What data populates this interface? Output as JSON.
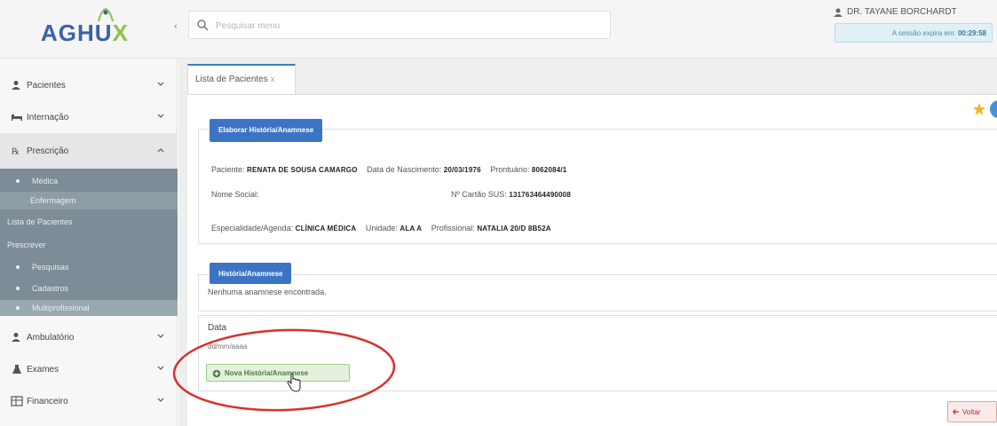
{
  "header": {
    "logo_text_main": "AGHU",
    "logo_text_accent": "X",
    "search_placeholder": "Pesquisar menu",
    "user_name": "DR. TAYANE BORCHARDT",
    "session_label": "A sessão expira em:",
    "session_time": "00:29:58"
  },
  "sidebar": {
    "items": [
      {
        "label": "Pacientes"
      },
      {
        "label": "Internação"
      },
      {
        "label": "Prescrição"
      },
      {
        "label": "Ambulatório"
      },
      {
        "label": "Exames"
      },
      {
        "label": "Financeiro"
      }
    ],
    "submenu": [
      {
        "label": "Médica"
      },
      {
        "label": "Enfermagem"
      },
      {
        "label": "Lista de Pacientes"
      },
      {
        "label": "Prescrever"
      },
      {
        "label": "Pesquisas"
      },
      {
        "label": "Cadastros"
      },
      {
        "label": "Multiprofissional"
      }
    ]
  },
  "tab": {
    "label": "Lista de Pacientes",
    "close": "x"
  },
  "panel1": {
    "button": "Elaborar História/Anamnese",
    "paciente_label": "Paciente:",
    "paciente_value": "RENATA DE SOUSA CAMARGO",
    "nascimento_label": "Data de Nascimento:",
    "nascimento_value": "20/03/1976",
    "prontuario_label": "Prontuário:",
    "prontuario_value": "8062084/1",
    "nome_social_label": "Nome Social:",
    "cartao_label": "Nº Cartão SUS:",
    "cartao_value": "131763464490008",
    "especialidade_label": "Especialidade/Agenda:",
    "especialidade_value": "CLÍNICA MÉDICA",
    "unidade_label": "Unidade:",
    "unidade_value": "ALA A",
    "profissional_label": "Profissional:",
    "profissional_value": "NATALIA 20/D 8B52A"
  },
  "panel2": {
    "button": "História/Anamnese",
    "empty_message": "Nenhuma anamnese encontrada."
  },
  "panel3": {
    "data_label": "Data",
    "data_placeholder": "dd/mm/aaaa",
    "new_button": "Nova História/Anamnese"
  },
  "footer": {
    "voltar": "Voltar"
  },
  "colors": {
    "primary_blue": "#3c74c5",
    "sidebar_submenu": "#7d8c96",
    "highlight_red": "#d9302c",
    "new_button_green": "#e4f1dc",
    "star_gold": "#f5b52a"
  }
}
